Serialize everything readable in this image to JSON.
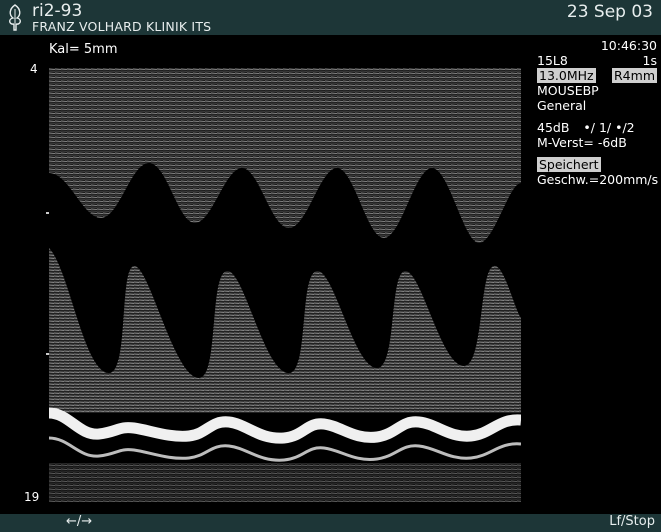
{
  "header": {
    "system_name": "ri2-93",
    "facility": "FRANZ VOLHARD KLINIK  ITS",
    "date": "23 Sep 03"
  },
  "calibration": "Kal= 5mm",
  "depth_scale": {
    "top": "4",
    "bottom": "19"
  },
  "settings": {
    "time": "10:46:30",
    "transducer": "15L8",
    "sweep": "1s",
    "frequency": "13.0MHz",
    "resolution": "R4mm",
    "preset": "MOUSEBP",
    "mode": "General",
    "gain": "45dB",
    "processing": "•/  1/  •/2",
    "m_gain": "M-Verst=  -6dB",
    "status": "Speichert",
    "sweep_speed": "Geschw.=200mm/s"
  },
  "footer": {
    "nav_arrows": "←/→",
    "lf_stop": "Lf/Stop"
  },
  "colors": {
    "header_bg": "#1d3637",
    "highlight_bg": "#cfcfcf"
  },
  "icons": {
    "logo": "tree-logo-icon"
  }
}
